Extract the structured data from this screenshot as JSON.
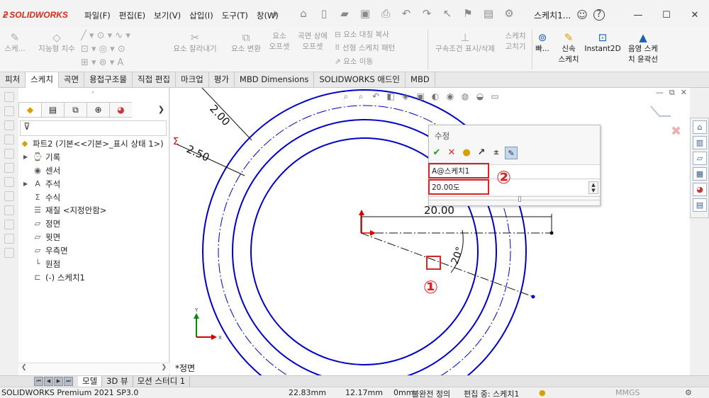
{
  "app": {
    "logo_text": "SOLIDWORKS",
    "document_title": "스케치1...",
    "menus": [
      "파일(F)",
      "편집(E)",
      "보기(V)",
      "삽입(I)",
      "도구(T)",
      "창(W)"
    ]
  },
  "command_manager": {
    "items": [
      {
        "label": "스케...",
        "icon": "sketch-icon",
        "enabled": false
      },
      {
        "label": "지능형 치수",
        "icon": "smart-dimension-icon",
        "enabled": false
      },
      {
        "label": "요소 잘라내기",
        "icon": "trim-icon",
        "enabled": false
      },
      {
        "label": "요소 변환",
        "icon": "convert-icon",
        "enabled": false
      },
      {
        "label": "요소\n오프셋",
        "icon": "offset-icon",
        "enabled": false
      },
      {
        "label": "곡면 상에\n오프셋",
        "icon": "surface-offset-icon",
        "enabled": false
      },
      {
        "label": "요소 대칭 복사",
        "icon": "mirror-icon",
        "enabled": false
      },
      {
        "label": "선형 스케치 패턴",
        "icon": "linear-pattern-icon",
        "enabled": false
      },
      {
        "label": "요소 이동",
        "icon": "move-icon",
        "enabled": false
      },
      {
        "label": "구속조건 표시/삭제",
        "icon": "relations-icon",
        "enabled": false
      },
      {
        "label": "스케치\n고치기",
        "icon": "repair-icon",
        "enabled": false
      },
      {
        "label": "빠...",
        "icon": "quick-snaps-icon",
        "enabled": true
      },
      {
        "label": "신속\n스케치",
        "icon": "rapid-sketch-icon",
        "enabled": true
      },
      {
        "label": "Instant2D",
        "icon": "instant2d-icon",
        "enabled": true
      },
      {
        "label": "음영 스케\n치 윤곽선",
        "icon": "shaded-contours-icon",
        "enabled": true
      }
    ]
  },
  "tabs": [
    "피처",
    "스케치",
    "곡면",
    "용접구조물",
    "직접 편집",
    "마크업",
    "평가",
    "MBD Dimensions",
    "SOLIDWORKS 애드인",
    "MBD"
  ],
  "active_tab": "스케치",
  "feature_manager": {
    "root": "파트2  (기본<<기본>_표시 상태 1>)",
    "items": [
      {
        "label": "기록",
        "icon": "history-icon",
        "expandable": true
      },
      {
        "label": "센서",
        "icon": "sensor-icon",
        "expandable": false
      },
      {
        "label": "주석",
        "icon": "annotation-icon",
        "expandable": true
      },
      {
        "label": "수식",
        "icon": "equation-icon",
        "expandable": false
      },
      {
        "label": "재질 <지정안함>",
        "icon": "material-icon",
        "expandable": false
      },
      {
        "label": "정면",
        "icon": "plane-icon",
        "expandable": false
      },
      {
        "label": "윗면",
        "icon": "plane-icon",
        "expandable": false
      },
      {
        "label": "우측면",
        "icon": "plane-icon",
        "expandable": false
      },
      {
        "label": "원점",
        "icon": "origin-icon",
        "expandable": false
      },
      {
        "label": "(-) 스케치1",
        "icon": "sketch-icon",
        "expandable": false
      }
    ]
  },
  "graphics": {
    "view_label": "*정면",
    "dimensions": {
      "diameter_top": "2.00",
      "diameter_left": "2.50",
      "linear": "20.00",
      "angle": "20°"
    }
  },
  "modify_dialog": {
    "title": "수정",
    "dimension_name": "A@스케치1",
    "value": "20.00도"
  },
  "callouts": [
    "①",
    "②"
  ],
  "bottom_tabs": [
    "모델",
    "3D 뷰",
    "모션 스터디 1"
  ],
  "active_bottom_tab": "모델",
  "status_bar": {
    "product": "SOLIDWORKS Premium 2021 SP3.0",
    "x": "22.83mm",
    "y": "12.17mm",
    "z": "0mm",
    "state": "불완전 정의",
    "editing": "편집 중: 스케치1",
    "units": "MMGS"
  },
  "colors": {
    "sketch_line": "#0000c8",
    "callout_red": "#d6262a",
    "origin_red": "#d40000"
  }
}
